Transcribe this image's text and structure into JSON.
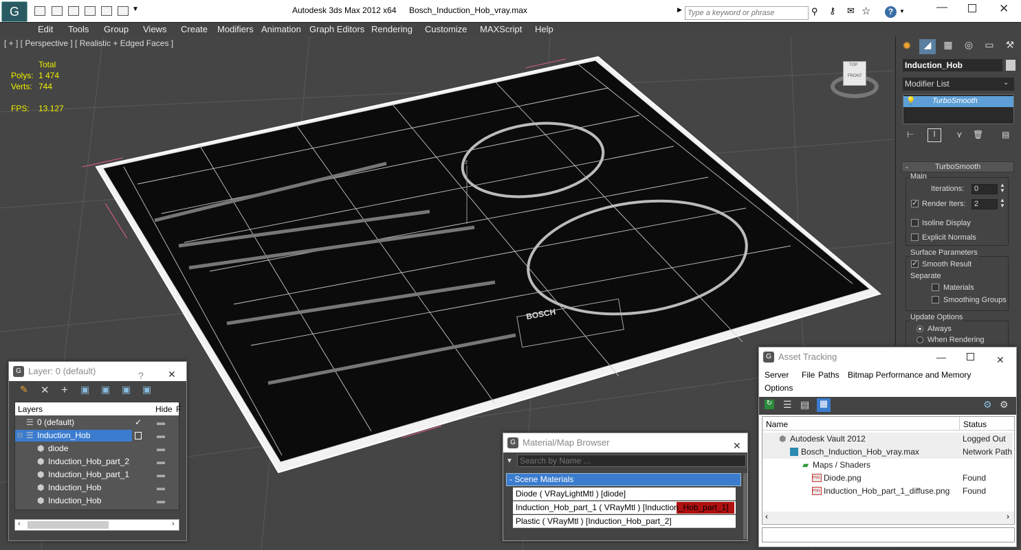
{
  "titlebar": {
    "app_title": "Autodesk 3ds Max  2012 x64",
    "file_name": "Bosch_Induction_Hob_vray.max",
    "search_placeholder": "Type a keyword or phrase"
  },
  "menu": [
    "Edit",
    "Tools",
    "Group",
    "Views",
    "Create",
    "Modifiers",
    "Animation",
    "Graph Editors",
    "Rendering",
    "Customize",
    "MAXScript",
    "Help"
  ],
  "viewport": {
    "label": "[ + ] [ Perspective ] [ Realistic + Edged Faces ]",
    "stats": {
      "total_label": "Total",
      "polys_label": "Polys:",
      "polys_value": "1 474",
      "verts_label": "Verts:",
      "verts_value": "744",
      "fps_label": "FPS:",
      "fps_value": "13.127"
    },
    "viewcube": {
      "top": "TOP",
      "front": "FRONT"
    },
    "axis_label": "z",
    "brand": "BOSCH"
  },
  "command_panel": {
    "object_name": "Induction_Hob",
    "modifier_list": "Modifier List",
    "stack_item": "TurboSmooth",
    "rollout_title": "TurboSmooth",
    "main_group": "Main",
    "iterations_label": "Iterations:",
    "iterations_value": "0",
    "render_iters_label": "Render Iters:",
    "render_iters_value": "2",
    "isoline_label": "Isoline Display",
    "explicit_normals_label": "Explicit Normals",
    "surface_group": "Surface Parameters",
    "smooth_result_label": "Smooth Result",
    "separate_label": "Separate",
    "materials_label": "Materials",
    "smoothing_groups_label": "Smoothing Groups",
    "update_group": "Update Options",
    "always_label": "Always",
    "when_rendering_label": "When Rendering"
  },
  "layer_window": {
    "title": "Layer: 0 (default)",
    "help": "?",
    "col_layers": "Layers",
    "col_hide": "Hide",
    "col_f": "F",
    "rows": [
      {
        "name": "0 (default)"
      },
      {
        "name": "Induction_Hob"
      },
      {
        "name": "diode"
      },
      {
        "name": "Induction_Hob_part_2"
      },
      {
        "name": "Induction_Hob_part_1"
      },
      {
        "name": "Induction_Hob"
      },
      {
        "name": "Induction_Hob"
      }
    ]
  },
  "material_browser": {
    "title": "Material/Map Browser",
    "search_placeholder": "Search by Name ...",
    "section": "- Scene Materials",
    "items": [
      "Diode  ( VRayLightMtl ) [diode]",
      "Induction_Hob_part_1  ( VRayMtl ) [Induction_Hob_part_1]",
      "Plastic  ( VRayMtl ) [Induction_Hob_part_2]"
    ]
  },
  "asset_tracking": {
    "title": "Asset Tracking",
    "menu": [
      "Server",
      "File",
      "Paths",
      "Bitmap Performance and Memory",
      "Options"
    ],
    "col_name": "Name",
    "col_status": "Status",
    "rows": [
      {
        "name": "Autodesk Vault 2012",
        "status": "Logged Out ..."
      },
      {
        "name": "Bosch_Induction_Hob_vray.max",
        "status": "Network Path"
      },
      {
        "name": "Maps / Shaders",
        "status": ""
      },
      {
        "name": "Diode.png",
        "status": "Found"
      },
      {
        "name": "Induction_Hob_part_1_diffuse.png",
        "status": "Found"
      }
    ]
  }
}
